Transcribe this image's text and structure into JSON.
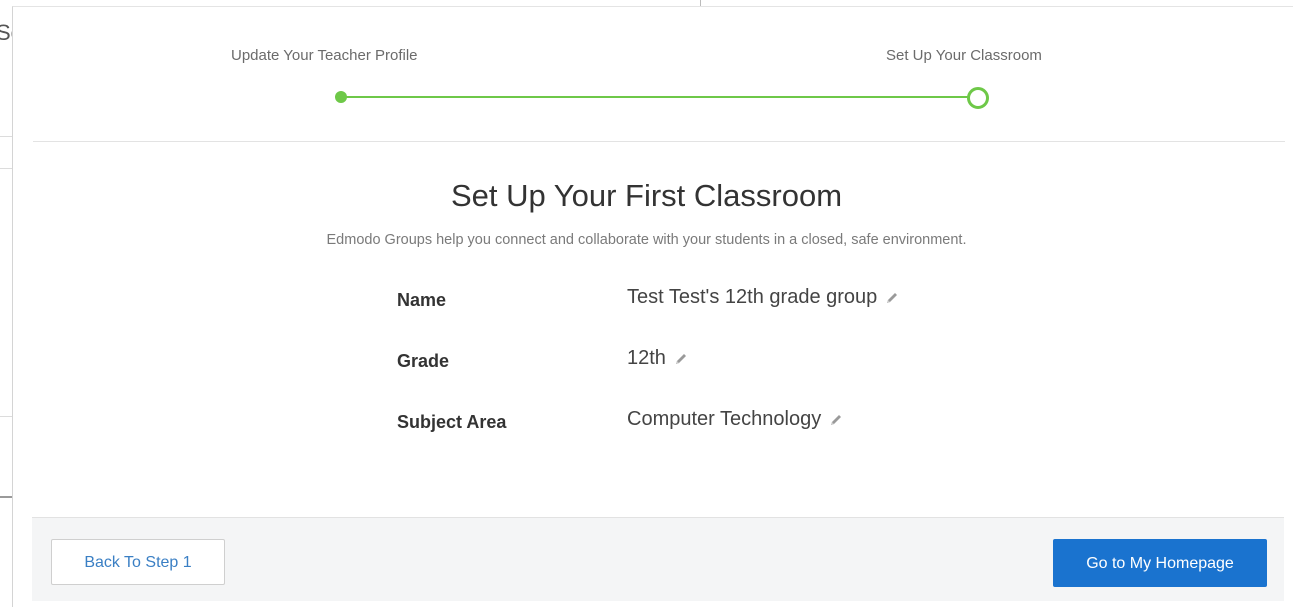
{
  "backdrop": {
    "partial_text": "Se"
  },
  "stepper": {
    "steps": [
      {
        "label": "Update Your Teacher Profile",
        "state": "completed"
      },
      {
        "label": "Set Up Your Classroom",
        "state": "current"
      }
    ],
    "color": "#6ec848"
  },
  "main": {
    "title": "Set Up Your First Classroom",
    "subtitle": "Edmodo Groups help you connect and collaborate with your students in a closed, safe environment.",
    "fields": [
      {
        "label": "Name",
        "value": "Test Test's 12th grade group",
        "icon": "pencil-icon"
      },
      {
        "label": "Grade",
        "value": "12th",
        "icon": "pencil-icon"
      },
      {
        "label": "Subject Area",
        "value": "Computer Technology",
        "icon": "pencil-icon"
      }
    ]
  },
  "footer": {
    "back_label": "Back To Step 1",
    "home_label": "Go to My Homepage",
    "primary_color": "#1a73cf"
  }
}
